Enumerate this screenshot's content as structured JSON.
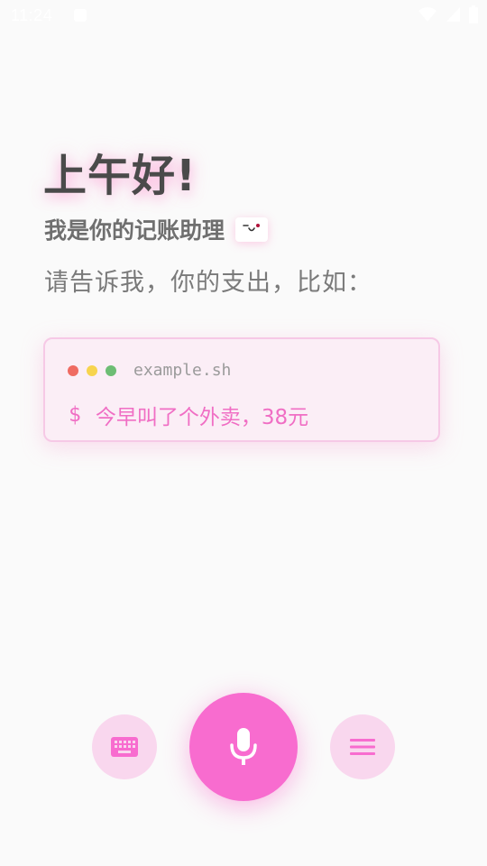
{
  "status_bar": {
    "time": "11:24"
  },
  "greeting": {
    "title": "上午好!",
    "subtitle": "我是你的记账助理",
    "prompt": "请告诉我，你的支出，比如："
  },
  "example_card": {
    "filename": "example.sh",
    "prompt_symbol": "$",
    "command": "今早叫了个外卖，38元",
    "dot_colors": [
      "#ef6b62",
      "#f7d44e",
      "#6dbd74"
    ]
  },
  "controls": {
    "keyboard_icon": "keyboard-icon",
    "mic_icon": "microphone-icon",
    "menu_icon": "menu-icon"
  },
  "colors": {
    "accent": "#f86ccf",
    "accent_light": "#f9d7ee",
    "background": "#fafafa"
  }
}
